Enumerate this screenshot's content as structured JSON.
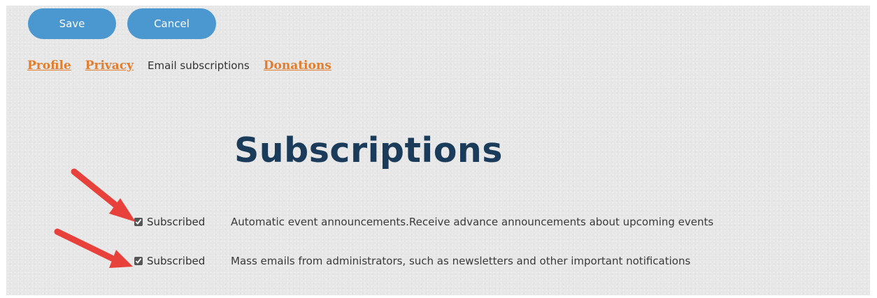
{
  "toolbar": {
    "save_label": "Save",
    "cancel_label": "Cancel"
  },
  "tabs": [
    {
      "label": "Profile",
      "link": true
    },
    {
      "label": "Privacy",
      "link": true
    },
    {
      "label": "Email subscriptions",
      "link": false
    },
    {
      "label": "Donations",
      "link": true
    }
  ],
  "page_title": "Subscriptions",
  "subscriptions": [
    {
      "checked": true,
      "status": "Subscribed",
      "description": "Automatic event announcements.Receive advance announcements about upcoming events"
    },
    {
      "checked": true,
      "status": "Subscribed",
      "description": "Mass emails from administrators, such as newsletters and other important notifications"
    }
  ],
  "colors": {
    "button": "#4a98cf",
    "tab_link": "#e37d2d",
    "title": "#1a3c5a",
    "arrow": "#e8413c"
  },
  "icons": {
    "annotation": "red-arrow-icon"
  }
}
